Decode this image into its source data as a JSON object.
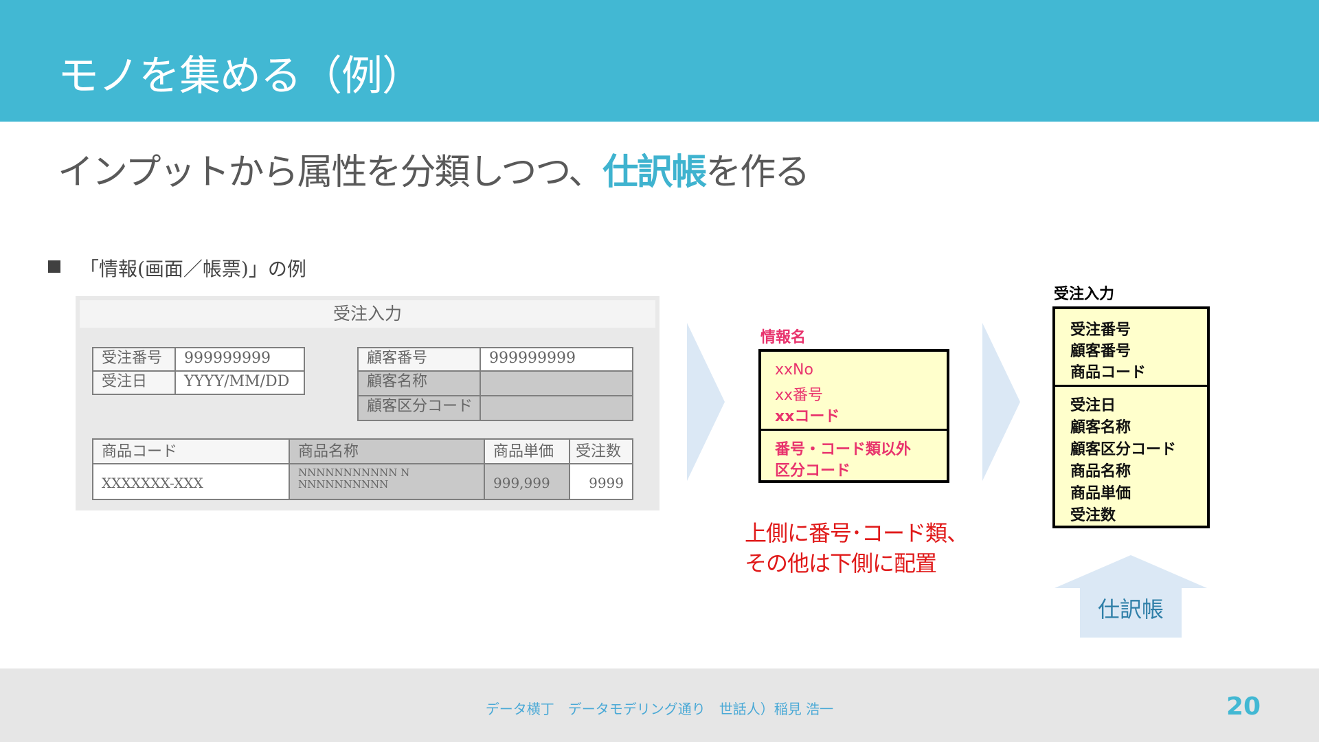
{
  "header": {
    "title": "モノを集める（例）",
    "color": "#42b8d3"
  },
  "subtitle": {
    "before": "インプットから属性を分類しつつ、",
    "highlight": "仕訳帳",
    "after": "を作る"
  },
  "bullet": {
    "text": "「情報(画面／帳票)」の例"
  },
  "form": {
    "title": "受注入力",
    "fields_left": [
      {
        "label": "受注番号",
        "value": "999999999"
      },
      {
        "label": "受注日",
        "value": "YYYY/MM/DD"
      }
    ],
    "fields_right": [
      {
        "label": "顧客番号",
        "value": "999999999"
      },
      {
        "label": "顧客名称",
        "value": ""
      },
      {
        "label": "顧客区分コード",
        "value": ""
      }
    ],
    "table": {
      "headers": [
        "商品コード",
        "商品名称",
        "商品単価",
        "受注数"
      ],
      "row": [
        "XXXXXXX-XXX",
        "NNNNNNNNNNN NNNNNNNNNNN",
        "999,999",
        "9999"
      ]
    }
  },
  "info": {
    "label": "情報名",
    "top_lines": [
      "xxNo",
      "xx番号",
      "xxコード"
    ],
    "bottom_lines": [
      "番号・コード類以外",
      "区分コード"
    ],
    "note": [
      "上側に番号･コード類、",
      "その他は下側に配置"
    ]
  },
  "ledger": {
    "label": "受注入力",
    "top_lines": [
      "受注番号",
      "顧客番号",
      "商品コード"
    ],
    "bottom_lines": [
      "受注日",
      "顧客名称",
      "顧客区分コード",
      "商品名称",
      "商品単価",
      "受注数"
    ],
    "arrow_label": "仕訳帳"
  },
  "footer": {
    "text": "データ横丁　データモデリング通り　世話人）稲見 浩一",
    "page": "20"
  }
}
